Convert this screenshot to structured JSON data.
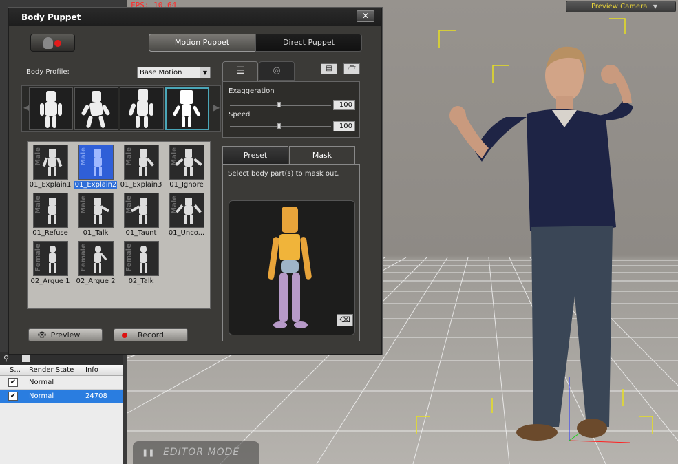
{
  "viewport": {
    "fps_text": "FPS: 10.64",
    "camera_label": "Preview Camera",
    "mode_label": "EDITOR MODE"
  },
  "scene_panel": {
    "columns": [
      "S...",
      "Render State",
      "Info"
    ],
    "rows": [
      {
        "checked": true,
        "render_state": "Normal",
        "info": ""
      },
      {
        "checked": true,
        "render_state": "Normal",
        "info": "24708",
        "selected": true
      }
    ]
  },
  "dialog": {
    "title": "Body Puppet",
    "close_label": "✕",
    "mode_tabs": [
      "Motion Puppet",
      "Direct Puppet"
    ],
    "profile_label": "Body Profile:",
    "profile_value": "Base Motion",
    "motions": [
      {
        "label": "01_Explain1",
        "gender": "Male"
      },
      {
        "label": "01_Explain2",
        "gender": "Male",
        "selected": true
      },
      {
        "label": "01_Explain3",
        "gender": "Male"
      },
      {
        "label": "01_Ignore",
        "gender": "Male"
      },
      {
        "label": "01_Refuse",
        "gender": "Male"
      },
      {
        "label": "01_Talk",
        "gender": "Male"
      },
      {
        "label": "01_Taunt",
        "gender": "Male"
      },
      {
        "label": "01_Unco...",
        "gender": "Male"
      },
      {
        "label": "02_Argue 1",
        "gender": "Female"
      },
      {
        "label": "02_Argue 2",
        "gender": "Female"
      },
      {
        "label": "02_Talk",
        "gender": "Female"
      }
    ],
    "preview_label": "Preview",
    "record_label": "Record",
    "sliders": [
      {
        "label": "Exaggeration",
        "value": "100"
      },
      {
        "label": "Speed",
        "value": "100"
      }
    ],
    "panel_tabs": [
      "Preset",
      "Mask"
    ],
    "mask_hint": "Select body part(s) to mask out."
  }
}
